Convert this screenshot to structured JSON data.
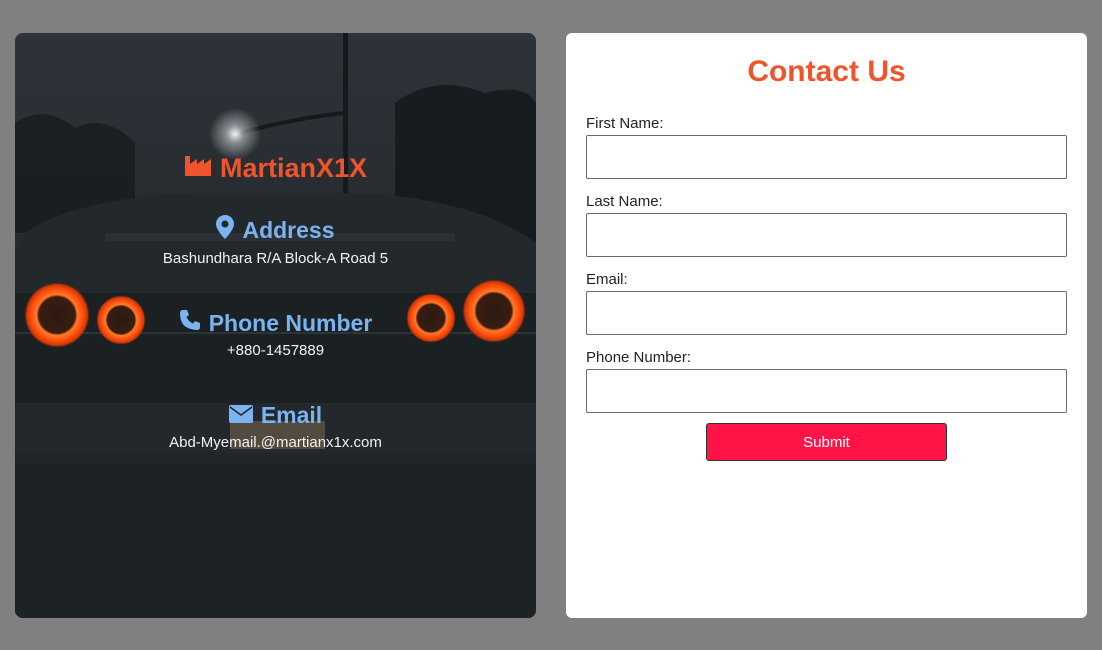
{
  "colors": {
    "brand": "#f0542c",
    "section_title": "#7ab3ef",
    "submit_bg": "#ff1447",
    "page_bg": "#808080"
  },
  "info_card": {
    "brand": {
      "name": "MartianX1X",
      "icon": "factory-icon"
    },
    "address": {
      "title": "Address",
      "icon": "map-marker-icon",
      "value": "Bashundhara R/A Block-A Road 5"
    },
    "phone": {
      "title": "Phone Number",
      "icon": "phone-icon",
      "value": "+880-1457889"
    },
    "email": {
      "title": "Email",
      "icon": "envelope-icon",
      "value": "Abd-Myemail.@martianx1x.com"
    }
  },
  "form": {
    "title": "Contact Us",
    "fields": [
      {
        "label": "First Name:",
        "value": "",
        "placeholder": ""
      },
      {
        "label": "Last Name:",
        "value": "",
        "placeholder": ""
      },
      {
        "label": "Email:",
        "value": "",
        "placeholder": ""
      },
      {
        "label": "Phone Number:",
        "value": "",
        "placeholder": ""
      }
    ],
    "submit_label": "Submit"
  }
}
